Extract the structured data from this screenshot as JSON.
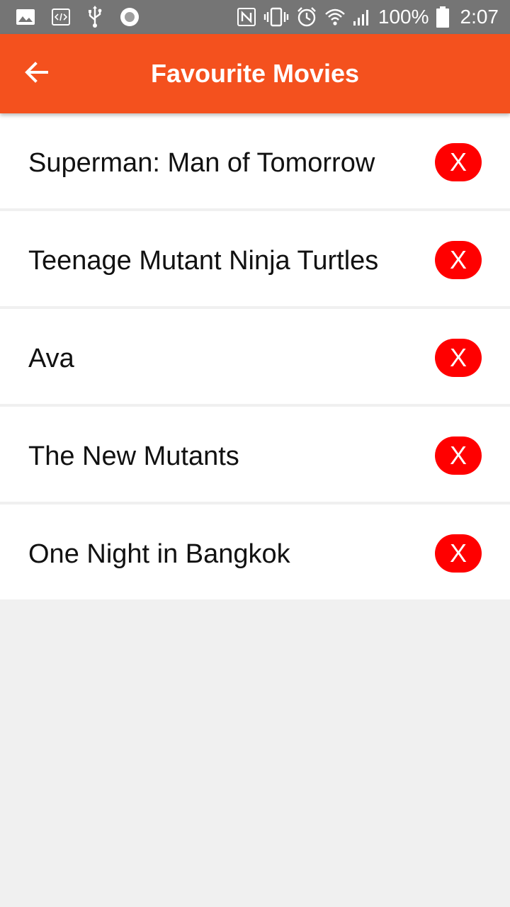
{
  "status_bar": {
    "battery_text": "100%",
    "clock_text": "2:07",
    "icons_left": [
      "image-icon",
      "code-icon",
      "usb-icon",
      "circle-icon"
    ],
    "icons_right": [
      "nfc-icon",
      "vibrate-icon",
      "alarm-icon",
      "wifi-icon",
      "signal-icon",
      "battery-icon"
    ]
  },
  "app_bar": {
    "title": "Favourite Movies",
    "back_icon": "arrow-back-icon",
    "background_color": "#f4511e"
  },
  "movies": [
    {
      "title": "Superman: Man of Tomorrow",
      "remove_label": "X"
    },
    {
      "title": "Teenage Mutant Ninja Turtles",
      "remove_label": "X"
    },
    {
      "title": "Ava",
      "remove_label": "X"
    },
    {
      "title": "The New Mutants",
      "remove_label": "X"
    },
    {
      "title": "One Night in Bangkok",
      "remove_label": "X"
    }
  ],
  "colors": {
    "accent": "#f4511e",
    "remove_button": "#ff0000",
    "page_background": "#f0f0f0"
  }
}
